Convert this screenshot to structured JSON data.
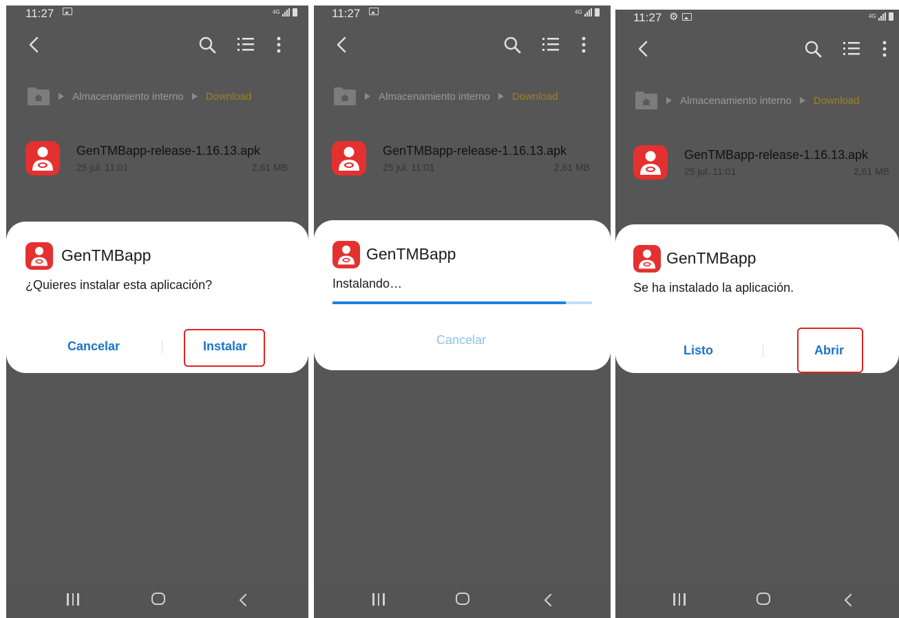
{
  "colors": {
    "accent": "#1a73c8",
    "app_red": "#e53030",
    "highlight_red": "#e0221f",
    "folder_current": "#a08020"
  },
  "icons": {
    "back": "chevron-left-icon",
    "search": "search-icon",
    "list": "list-view-icon",
    "more": "more-vert-icon",
    "folder": "home-folder-icon",
    "app": "gentmbapp-icon",
    "nav_recents": "recents-icon",
    "nav_home": "home-icon",
    "nav_back": "back-icon"
  },
  "screens": [
    {
      "status": {
        "time": "11:27",
        "network": "4G"
      },
      "breadcrumb": {
        "root": "Almacenamiento interno",
        "current": "Download"
      },
      "file": {
        "name": "GenTMBapp-release-1.16.13.apk",
        "date": "25 jul. 11:01",
        "size": "2,61 MB"
      },
      "dialog": {
        "title": "GenTMBapp",
        "message": "¿Quieres instalar esta aplicación?",
        "left_button": "Cancelar",
        "right_button": "Instalar"
      }
    },
    {
      "status": {
        "time": "11:27",
        "network": "4G"
      },
      "breadcrumb": {
        "root": "Almacenamiento interno",
        "current": "Download"
      },
      "file": {
        "name": "GenTMBapp-release-1.16.13.apk",
        "date": "25 jul. 11:01",
        "size": "2,61 MB"
      },
      "dialog": {
        "title": "GenTMBapp",
        "message": "Instalando…",
        "progress": 0.9,
        "button": "Cancelar"
      }
    },
    {
      "status": {
        "time": "11:27",
        "network": "4G"
      },
      "breadcrumb": {
        "root": "Almacenamiento interno",
        "current": "Download"
      },
      "file": {
        "name": "GenTMBapp-release-1.16.13.apk",
        "date": "25 jul. 11:01",
        "size": "2,61 MB"
      },
      "dialog": {
        "title": "GenTMBapp",
        "message": "Se ha instalado la aplicación.",
        "left_button": "Listo",
        "right_button": "Abrir"
      }
    }
  ]
}
